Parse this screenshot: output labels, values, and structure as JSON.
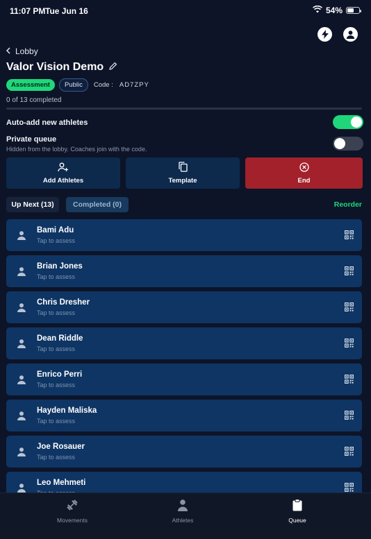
{
  "status_bar": {
    "time": "11:07 PM",
    "date": "Tue Jun 16",
    "battery": "54%",
    "battery_level": 0.54
  },
  "header": {
    "back_label": "Lobby",
    "title": "Valor Vision Demo"
  },
  "tags": {
    "type": "Assessment",
    "visibility": "Public",
    "code_label": "Code :",
    "code_value": "AD7ZPY"
  },
  "progress": {
    "text": "0 of 13 completed",
    "completed": 0,
    "total": 13
  },
  "settings": {
    "auto_add": {
      "label": "Auto-add new athletes",
      "on": true
    },
    "private_queue": {
      "label": "Private queue",
      "description": "Hidden from the lobby. Coaches join with the code.",
      "on": false
    }
  },
  "actions": {
    "add_athletes": "Add Athletes",
    "template": "Template",
    "end": "End"
  },
  "queue_tabs": {
    "up_next": "Up Next (13)",
    "completed": "Completed (0)",
    "reorder": "Reorder"
  },
  "athletes": [
    {
      "name": "Bami Adu",
      "sub": "Tap to assess"
    },
    {
      "name": "Brian Jones",
      "sub": "Tap to assess"
    },
    {
      "name": "Chris Dresher",
      "sub": "Tap to assess"
    },
    {
      "name": "Dean Riddle",
      "sub": "Tap to assess"
    },
    {
      "name": "Enrico Perri",
      "sub": "Tap to assess"
    },
    {
      "name": "Hayden Maliska",
      "sub": "Tap to assess"
    },
    {
      "name": "Joe Rosauer",
      "sub": "Tap to assess"
    },
    {
      "name": "Leo Mehmeti",
      "sub": "Tap to assess"
    }
  ],
  "bottom_nav": {
    "movements": "Movements",
    "athletes": "Athletes",
    "queue": "Queue",
    "active": "queue"
  },
  "colors": {
    "accent": "#1fd77a",
    "danger": "#a2212b",
    "card": "#0e3564",
    "background": "#0d1428"
  },
  "icons": {
    "wifi": "wifi-icon",
    "battery": "battery-icon",
    "bolt": "lightning-icon",
    "profile": "profile-icon",
    "back": "chevron-left-icon",
    "edit": "pencil-icon",
    "add_user": "add-user-icon",
    "template": "copy-icon",
    "end": "close-circle-icon",
    "avatar": "person-icon",
    "qr": "qr-code-icon",
    "movements": "dumbbell-icon",
    "athletes_tab": "person-icon",
    "queue": "clipboard-icon"
  }
}
